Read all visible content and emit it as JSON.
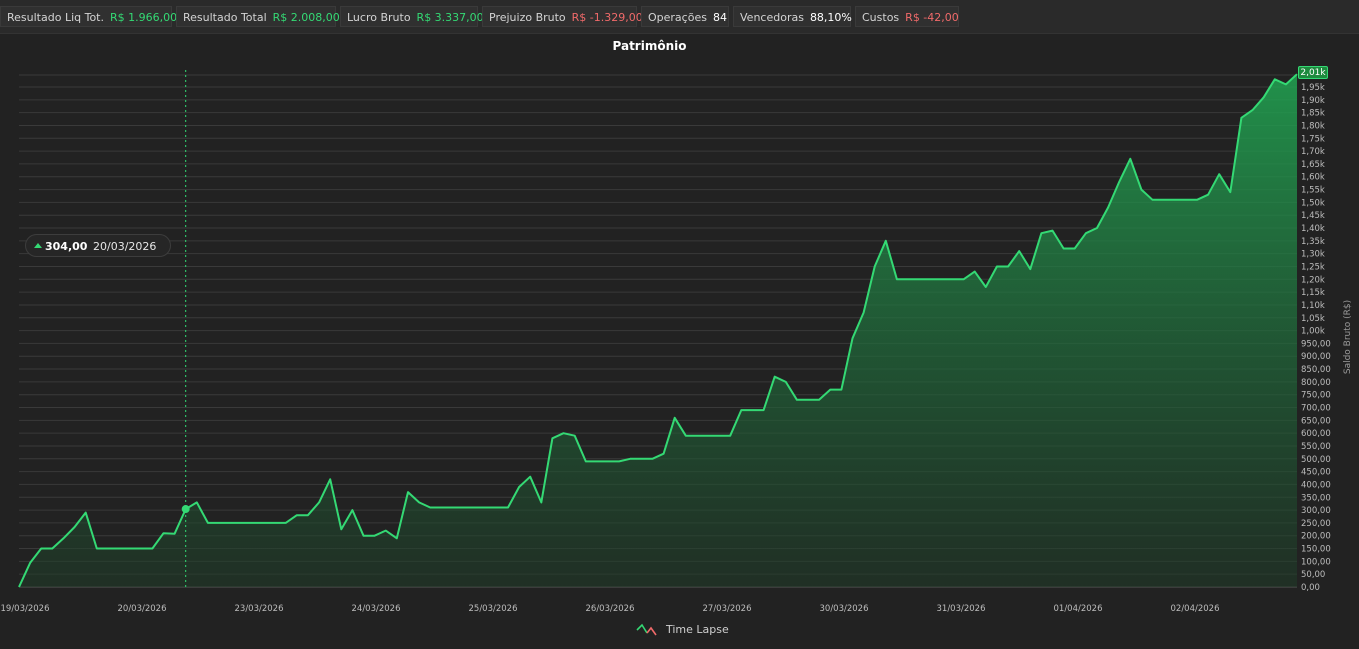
{
  "stats": [
    {
      "label": "Resultado Liq Tot.",
      "value": "R$ 1.966,00",
      "tone": "pos"
    },
    {
      "label": "Resultado Total",
      "value": "R$ 2.008,00",
      "tone": "pos"
    },
    {
      "label": "Lucro Bruto",
      "value": "R$ 3.337,00",
      "tone": "pos"
    },
    {
      "label": "Prejuizo Bruto",
      "value": "R$ -1.329,00",
      "tone": "neg"
    },
    {
      "label": "Operações",
      "value": "84",
      "tone": "neu"
    },
    {
      "label": "Vencedoras",
      "value": "88,10%",
      "tone": "neu"
    },
    {
      "label": "Custos",
      "value": "R$ -42,00",
      "tone": "neg"
    }
  ],
  "tooltip": {
    "value": "304,00",
    "date": "20/03/2026"
  },
  "legend": {
    "label": "Time Lapse",
    "icon": "line-chart-icon"
  },
  "last_value_badge": "2,01k",
  "colors": {
    "line": "#34d974",
    "negative": "#f06a6a",
    "background": "#222222"
  },
  "chart_data": {
    "type": "area",
    "title": "Patrimônio",
    "ylabel": "Saldo Bruto (R$)",
    "ylim": [
      0,
      2000
    ],
    "y_ticks": [
      "0,00",
      "50,00",
      "100,00",
      "150,00",
      "200,00",
      "250,00",
      "300,00",
      "350,00",
      "400,00",
      "450,00",
      "500,00",
      "550,00",
      "600,00",
      "650,00",
      "700,00",
      "750,00",
      "800,00",
      "850,00",
      "900,00",
      "950,00",
      "1,00k",
      "1,05k",
      "1,10k",
      "1,15k",
      "1,20k",
      "1,25k",
      "1,30k",
      "1,35k",
      "1,40k",
      "1,45k",
      "1,50k",
      "1,55k",
      "1,60k",
      "1,65k",
      "1,70k",
      "1,75k",
      "1,80k",
      "1,85k",
      "1,90k",
      "1,95k"
    ],
    "x_ticks": [
      "19/03/2026",
      "20/03/2026",
      "23/03/2026",
      "24/03/2026",
      "25/03/2026",
      "26/03/2026",
      "27/03/2026",
      "30/03/2026",
      "31/03/2026",
      "01/04/2026",
      "02/04/2026"
    ],
    "grid": true,
    "series": [
      {
        "values": [
          0,
          94,
          150,
          150,
          190,
          234,
          290,
          150,
          150,
          150,
          150,
          150,
          150,
          210,
          208,
          304,
          330,
          250,
          250,
          250,
          250,
          250,
          250,
          250,
          250,
          280,
          280,
          330,
          420,
          225,
          300,
          200,
          200,
          220,
          190,
          370,
          330,
          310,
          310,
          310,
          310,
          310,
          310,
          310,
          310,
          390,
          430,
          330,
          580,
          600,
          590,
          490,
          490,
          490,
          490,
          500,
          500,
          500,
          520,
          660,
          590,
          590,
          590,
          590,
          590,
          690,
          690,
          690,
          820,
          800,
          730,
          730,
          730,
          770,
          770,
          970,
          1070,
          1250,
          1350,
          1200,
          1200,
          1200,
          1200,
          1200,
          1200,
          1200,
          1230,
          1170,
          1250,
          1250,
          1310,
          1240,
          1380,
          1390,
          1320,
          1320,
          1380,
          1400,
          1480,
          1580,
          1670,
          1550,
          1510,
          1510,
          1510,
          1510,
          1510,
          1530,
          1610,
          1540,
          1830,
          1860,
          1910,
          1980,
          1960,
          2000
        ]
      }
    ]
  }
}
